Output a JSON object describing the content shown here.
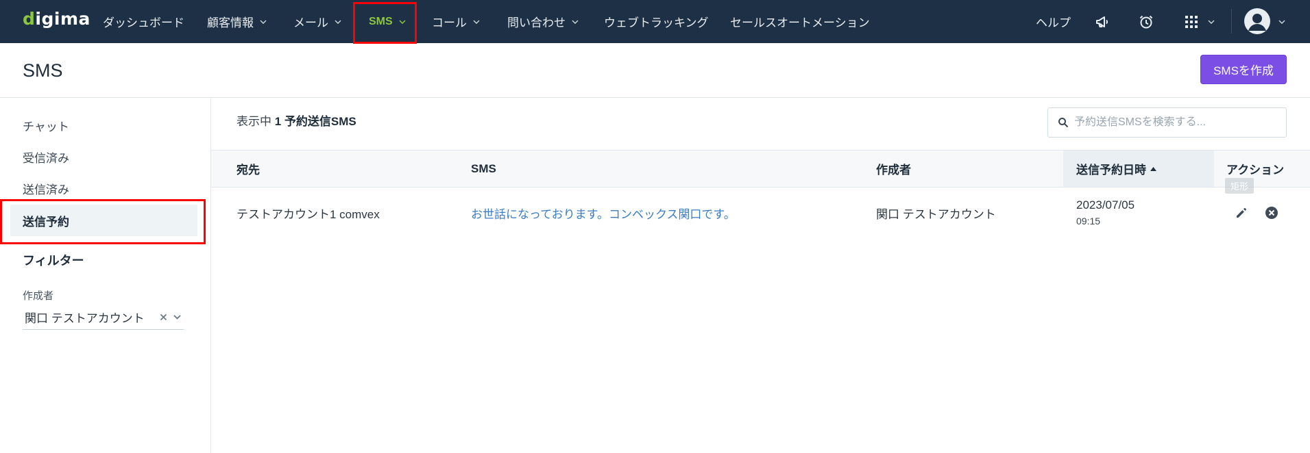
{
  "logo": {
    "text": "digima"
  },
  "nav": {
    "items": [
      {
        "label": "ダッシュボード",
        "has_dropdown": false
      },
      {
        "label": "顧客情報",
        "has_dropdown": true
      },
      {
        "label": "メール",
        "has_dropdown": true
      },
      {
        "label": "SMS",
        "has_dropdown": true,
        "active": true
      },
      {
        "label": "コール",
        "has_dropdown": true
      },
      {
        "label": "問い合わせ",
        "has_dropdown": true
      },
      {
        "label": "ウェブトラッキング",
        "has_dropdown": false
      },
      {
        "label": "セールスオートメーション",
        "has_dropdown": false
      }
    ],
    "help_label": "ヘルプ",
    "icons": [
      "megaphone-icon",
      "alarm-clock-icon",
      "app-grid-icon",
      "chevron-down-icon",
      "user-avatar-icon",
      "chevron-down-icon"
    ]
  },
  "page": {
    "title": "SMS",
    "create_button_label": "SMSを作成"
  },
  "sidebar": {
    "items": [
      {
        "label": "チャット",
        "active": false
      },
      {
        "label": "受信済み",
        "active": false
      },
      {
        "label": "送信済み",
        "active": false
      },
      {
        "label": "送信予約",
        "active": true
      }
    ],
    "filter_heading": "フィルター",
    "filters": {
      "creator_label": "作成者",
      "creator_value": "関口 テストアカウント"
    }
  },
  "list": {
    "showing_prefix": "表示中",
    "count": "1",
    "type_label": "予約送信SMS",
    "search_placeholder": "予約送信SMSを検索する..."
  },
  "table": {
    "columns": [
      {
        "key": "recipient",
        "label": "宛先"
      },
      {
        "key": "message",
        "label": "SMS"
      },
      {
        "key": "creator",
        "label": "作成者"
      },
      {
        "key": "scheduled_at",
        "label": "送信予約日時",
        "sort": "ascending"
      },
      {
        "key": "actions",
        "label": "アクション"
      }
    ],
    "rows": [
      {
        "recipient": "テストアカウント1 comvex",
        "message": "お世話になっております。コンベックス関口です。",
        "creator": "関口 テストアカウント",
        "date": "2023/07/05",
        "time": "09:15",
        "actions": [
          "pencil-edit-icon",
          "circle-close-icon"
        ]
      }
    ]
  },
  "overlay": {
    "tooltip_label": "矩形"
  },
  "colors": {
    "nav_bg": "#1d3045",
    "accent_green": "#8dc63f",
    "primary_purple": "#7b4fe6",
    "link_blue": "#3a7cc4",
    "annotation_red": "#ff0000"
  }
}
